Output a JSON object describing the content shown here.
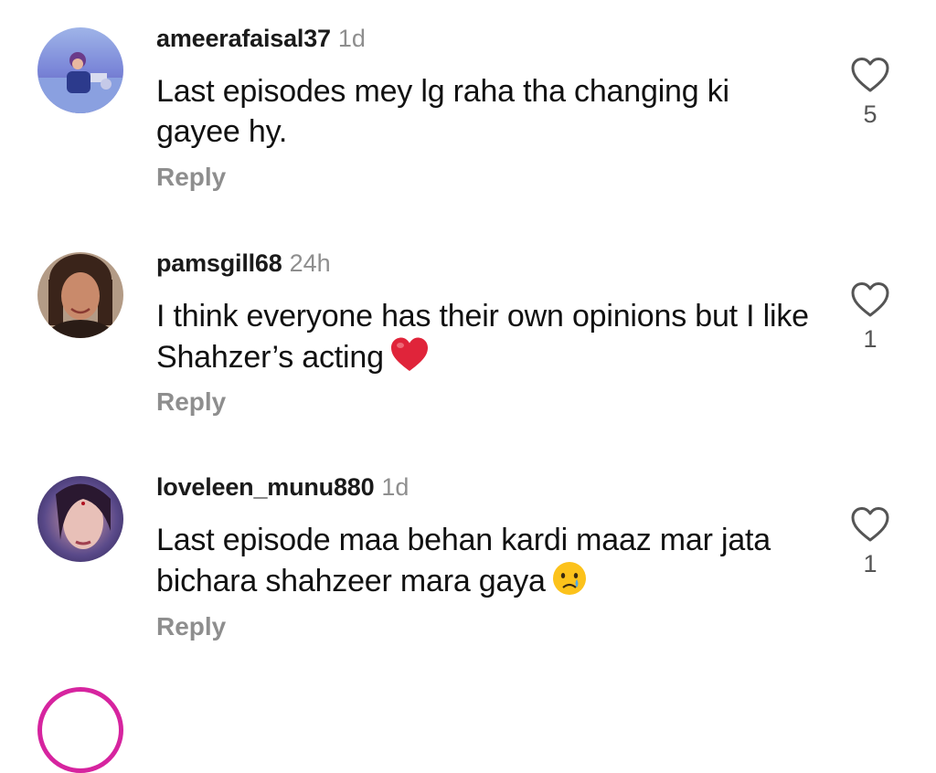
{
  "comments": [
    {
      "username": "ameerafaisal37",
      "time": "1d",
      "text": "Last episodes mey lg raha tha changing ki gayee hy.",
      "emoji": "",
      "reply_label": "Reply",
      "likes": "5"
    },
    {
      "username": "pamsgill68",
      "time": "24h",
      "text": "I think everyone has their own opinions but I like Shahzer’s acting",
      "emoji": "red-heart",
      "reply_label": "Reply",
      "likes": "1"
    },
    {
      "username": "loveleen_munu880",
      "time": "1d",
      "text": "Last episode maa behan kardi maaz mar jata bichara shahzeer mara gaya",
      "emoji": "crying-face",
      "reply_label": "Reply",
      "likes": "1"
    }
  ],
  "icons": {
    "like": "heart-outline-icon"
  },
  "colors": {
    "muted": "#8e8e8e",
    "heart": "#e0243a",
    "story_ring": "#d6249f"
  }
}
